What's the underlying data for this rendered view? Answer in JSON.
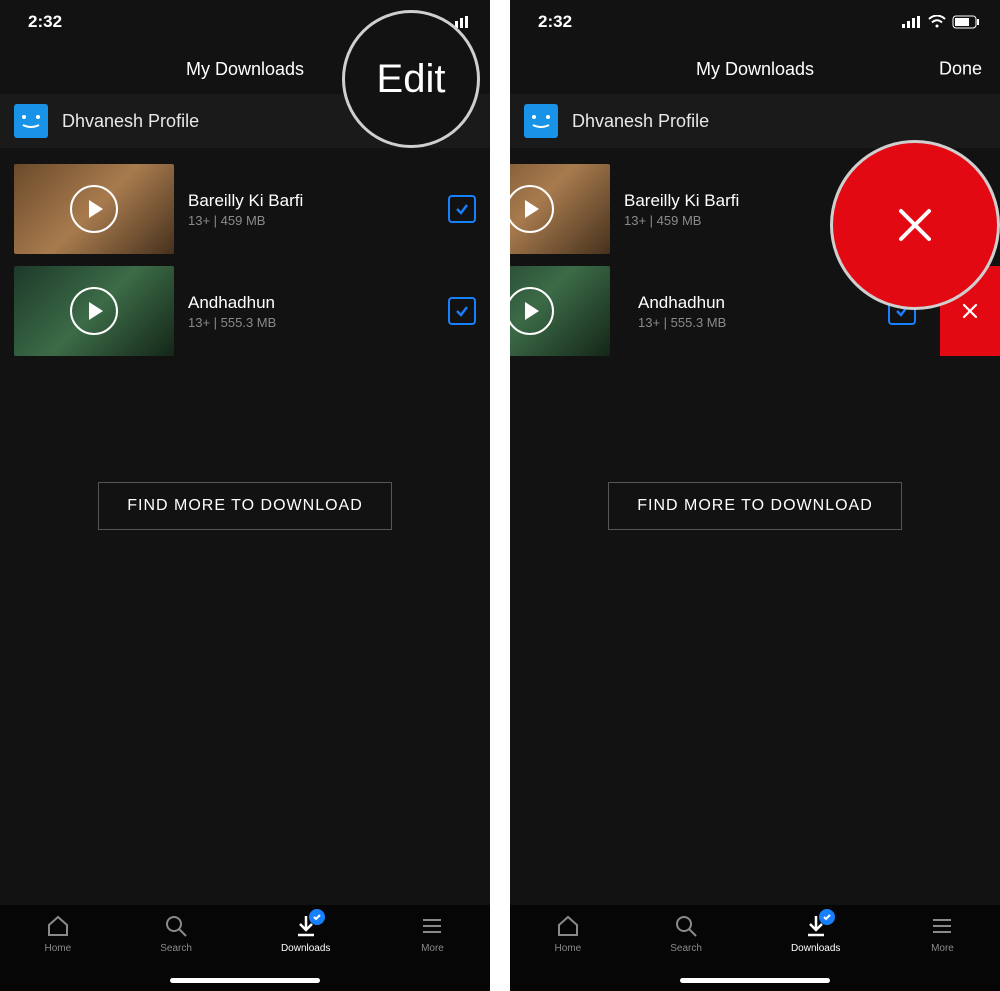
{
  "status": {
    "time": "2:32"
  },
  "header": {
    "title": "My Downloads",
    "action_edit": "Edit",
    "action_done": "Done"
  },
  "profile": {
    "name": "Dhvanesh Profile"
  },
  "downloads": [
    {
      "title": "Bareilly Ki Barfi",
      "sub": "13+ | 459 MB"
    },
    {
      "title": "Andhadhun",
      "sub": "13+ | 555.3 MB"
    }
  ],
  "cta": {
    "find_more": "FIND MORE TO DOWNLOAD"
  },
  "tabs": {
    "home": "Home",
    "search": "Search",
    "downloads": "Downloads",
    "more": "More"
  },
  "colors": {
    "accent": "#1680ff",
    "danger": "#e30913"
  }
}
